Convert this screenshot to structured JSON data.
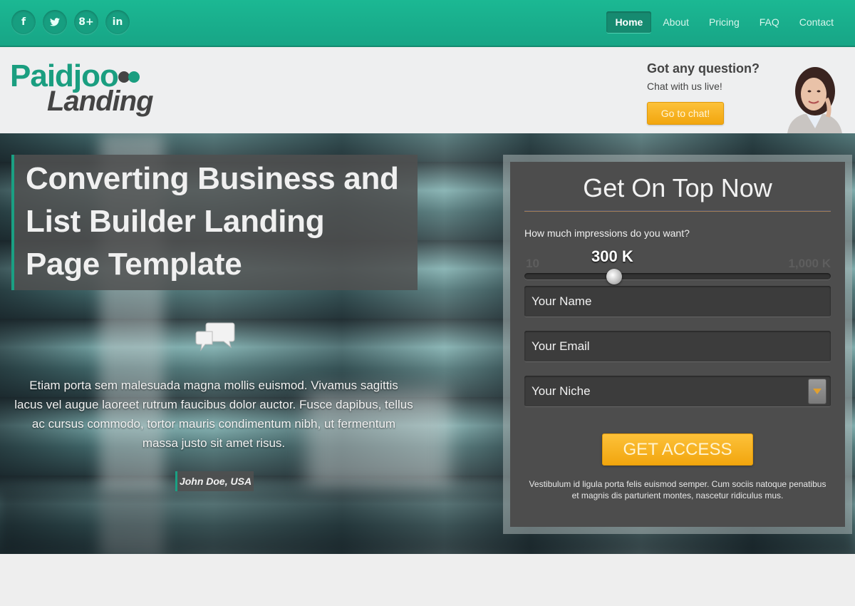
{
  "topbar": {
    "social": [
      {
        "icon": "facebook-icon",
        "glyph": "f"
      },
      {
        "icon": "twitter-icon",
        "glyph": "t"
      },
      {
        "icon": "google-plus-icon",
        "glyph": "8+"
      },
      {
        "icon": "linkedin-icon",
        "glyph": "in"
      }
    ],
    "nav": [
      {
        "label": "Home",
        "active": true
      },
      {
        "label": "About",
        "active": false
      },
      {
        "label": "Pricing",
        "active": false
      },
      {
        "label": "FAQ",
        "active": false
      },
      {
        "label": "Contact",
        "active": false
      }
    ]
  },
  "header": {
    "logo_line1": "Paidjoo",
    "logo_line2": "Landing",
    "question_title": "Got any question?",
    "question_sub": "Chat with us live!",
    "chat_button": "Go to chat!"
  },
  "hero": {
    "headline": "Converting Business and List Builder Landing Page Template",
    "testimonial": "Etiam porta sem malesuada magna mollis euismod. Vivamus sagittis lacus vel augue laoreet rutrum faucibus dolor auctor. Fusce dapibus, tellus ac cursus commodo, tortor mauris condimentum nibh, ut fermentum massa justo sit amet risus.",
    "author": "John Doe, USA"
  },
  "form": {
    "title": "Get On Top Now",
    "question": "How much impressions do you want?",
    "slider": {
      "min_label": "10",
      "max_label": "1,000 K",
      "value_label": "300 K",
      "min": 10,
      "max": 1000,
      "value": 300
    },
    "name_placeholder": "Your Name",
    "email_placeholder": "Your Email",
    "niche_selected": "Your Niche",
    "submit": "GET ACCESS",
    "fine_print": "Vestibulum id ligula porta felis euismod semper. Cum sociis natoque penatibus et magnis dis parturient montes, nascetur ridiculus mus."
  },
  "colors": {
    "brand": "#1aa083",
    "accent": "#f5ae1c",
    "dark_text": "#444444"
  }
}
